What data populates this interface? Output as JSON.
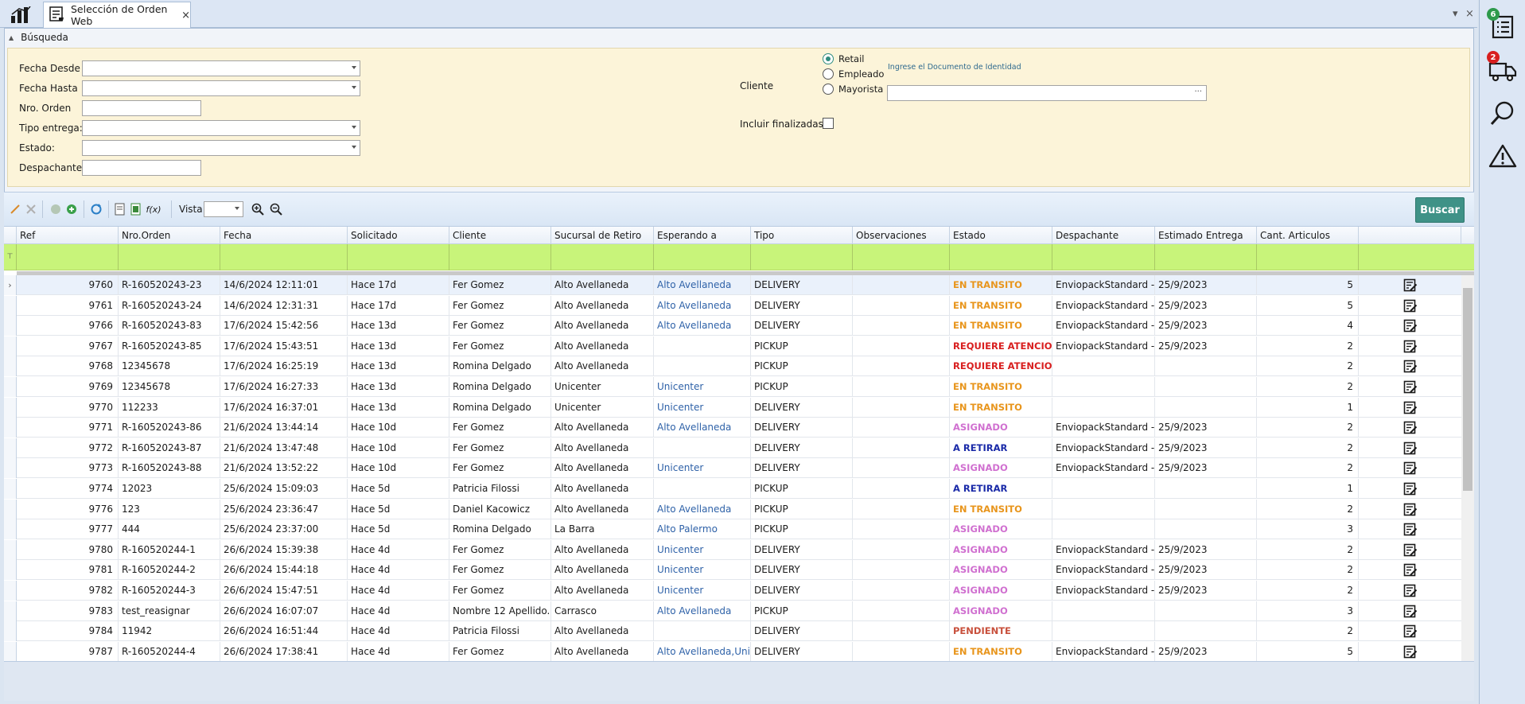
{
  "tab": {
    "title": "Selección de Orden Web",
    "close": "×"
  },
  "window": {
    "menu": "▾",
    "close": "×"
  },
  "search": {
    "section_title": "Búsqueda",
    "fecha_desde_label": "Fecha Desde",
    "fecha_hasta_label": "Fecha Hasta",
    "nro_orden_label": "Nro. Orden",
    "tipo_entrega_label": "Tipo entrega:",
    "estado_label": "Estado:",
    "despachante_label": "Despachante:",
    "cliente_label": "Cliente",
    "cliente_options": [
      "Retail",
      "Empleado",
      "Mayorista"
    ],
    "cliente_selected": "Retail",
    "documento_hint": "Ingrese el Documento de Identidad",
    "documento_dots": "···",
    "incluir_finalizadas_label": "Incluir finalizadas"
  },
  "toolbar": {
    "vista_label": "Vista",
    "search_button": "Buscar"
  },
  "grid": {
    "columns": [
      "Ref",
      "Nro.Orden",
      "Fecha",
      "Solicitado",
      "Cliente",
      "Sucursal de Retiro",
      "Esperando a",
      "Tipo",
      "Observaciones",
      "Estado",
      "Despachante",
      "Estimado Entrega",
      "Cant. Articulos"
    ],
    "rows": [
      {
        "ref": "9760",
        "orden": "R-160520243-23",
        "fecha": "14/6/2024 12:11:01",
        "solicitado": "Hace 17d",
        "cliente": "Fer Gomez",
        "sucursal": "Alto Avellaneda",
        "esperando": "Alto Avellaneda",
        "tipo": "DELIVERY",
        "obs": "",
        "estado": "EN TRANSITO",
        "despachante": "EnviopackStandard -...",
        "estimado": "25/9/2023",
        "cant": "5"
      },
      {
        "ref": "9761",
        "orden": "R-160520243-24",
        "fecha": "14/6/2024 12:31:31",
        "solicitado": "Hace 17d",
        "cliente": "Fer Gomez",
        "sucursal": "Alto Avellaneda",
        "esperando": "Alto Avellaneda",
        "tipo": "DELIVERY",
        "obs": "",
        "estado": "EN TRANSITO",
        "despachante": "EnviopackStandard -...",
        "estimado": "25/9/2023",
        "cant": "5"
      },
      {
        "ref": "9766",
        "orden": "R-160520243-83",
        "fecha": "17/6/2024 15:42:56",
        "solicitado": "Hace 13d",
        "cliente": "Fer Gomez",
        "sucursal": "Alto Avellaneda",
        "esperando": "Alto Avellaneda",
        "tipo": "DELIVERY",
        "obs": "",
        "estado": "EN TRANSITO",
        "despachante": "EnviopackStandard -...",
        "estimado": "25/9/2023",
        "cant": "4"
      },
      {
        "ref": "9767",
        "orden": "R-160520243-85",
        "fecha": "17/6/2024 15:43:51",
        "solicitado": "Hace 13d",
        "cliente": "Fer Gomez",
        "sucursal": "Alto Avellaneda",
        "esperando": "",
        "tipo": "PICKUP",
        "obs": "",
        "estado": "REQUIERE ATENCION",
        "despachante": "EnviopackStandard -...",
        "estimado": "25/9/2023",
        "cant": "2"
      },
      {
        "ref": "9768",
        "orden": "12345678",
        "fecha": "17/6/2024 16:25:19",
        "solicitado": "Hace 13d",
        "cliente": "Romina Delgado",
        "sucursal": "Alto Avellaneda",
        "esperando": "",
        "tipo": "PICKUP",
        "obs": "",
        "estado": "REQUIERE ATENCION",
        "despachante": "",
        "estimado": "",
        "cant": "2"
      },
      {
        "ref": "9769",
        "orden": "12345678",
        "fecha": "17/6/2024 16:27:33",
        "solicitado": "Hace 13d",
        "cliente": "Romina Delgado",
        "sucursal": "Unicenter",
        "esperando": "Unicenter",
        "tipo": "PICKUP",
        "obs": "",
        "estado": "EN TRANSITO",
        "despachante": "",
        "estimado": "",
        "cant": "2"
      },
      {
        "ref": "9770",
        "orden": "112233",
        "fecha": "17/6/2024 16:37:01",
        "solicitado": "Hace 13d",
        "cliente": "Romina Delgado",
        "sucursal": "Unicenter",
        "esperando": "Unicenter",
        "tipo": "DELIVERY",
        "obs": "",
        "estado": "EN TRANSITO",
        "despachante": "",
        "estimado": "",
        "cant": "1"
      },
      {
        "ref": "9771",
        "orden": "R-160520243-86",
        "fecha": "21/6/2024 13:44:14",
        "solicitado": "Hace 10d",
        "cliente": "Fer Gomez",
        "sucursal": "Alto Avellaneda",
        "esperando": "Alto Avellaneda",
        "tipo": "DELIVERY",
        "obs": "",
        "estado": "ASIGNADO",
        "despachante": "EnviopackStandard -...",
        "estimado": "25/9/2023",
        "cant": "2"
      },
      {
        "ref": "9772",
        "orden": "R-160520243-87",
        "fecha": "21/6/2024 13:47:48",
        "solicitado": "Hace 10d",
        "cliente": "Fer Gomez",
        "sucursal": "Alto Avellaneda",
        "esperando": "",
        "tipo": "DELIVERY",
        "obs": "",
        "estado": "A RETIRAR",
        "despachante": "EnviopackStandard -...",
        "estimado": "25/9/2023",
        "cant": "2"
      },
      {
        "ref": "9773",
        "orden": "R-160520243-88",
        "fecha": "21/6/2024 13:52:22",
        "solicitado": "Hace 10d",
        "cliente": "Fer Gomez",
        "sucursal": "Alto Avellaneda",
        "esperando": "Unicenter",
        "tipo": "DELIVERY",
        "obs": "",
        "estado": "ASIGNADO",
        "despachante": "EnviopackStandard -...",
        "estimado": "25/9/2023",
        "cant": "2"
      },
      {
        "ref": "9774",
        "orden": "12023",
        "fecha": "25/6/2024 15:09:03",
        "solicitado": "Hace 5d",
        "cliente": "Patricia Filossi",
        "sucursal": "Alto Avellaneda",
        "esperando": "",
        "tipo": "PICKUP",
        "obs": "",
        "estado": "A RETIRAR",
        "despachante": "",
        "estimado": "",
        "cant": "1"
      },
      {
        "ref": "9776",
        "orden": "123",
        "fecha": "25/6/2024 23:36:47",
        "solicitado": "Hace 5d",
        "cliente": "Daniel Kacowicz",
        "sucursal": "Alto Avellaneda",
        "esperando": "Alto Avellaneda",
        "tipo": "PICKUP",
        "obs": "",
        "estado": "EN TRANSITO",
        "despachante": "",
        "estimado": "",
        "cant": "2"
      },
      {
        "ref": "9777",
        "orden": "444",
        "fecha": "25/6/2024 23:37:00",
        "solicitado": "Hace 5d",
        "cliente": "Romina Delgado",
        "sucursal": "La Barra",
        "esperando": "Alto Palermo",
        "tipo": "PICKUP",
        "obs": "",
        "estado": "ASIGNADO",
        "despachante": "",
        "estimado": "",
        "cant": "3"
      },
      {
        "ref": "9780",
        "orden": "R-160520244-1",
        "fecha": "26/6/2024 15:39:38",
        "solicitado": "Hace 4d",
        "cliente": "Fer Gomez",
        "sucursal": "Alto Avellaneda",
        "esperando": "Unicenter",
        "tipo": "DELIVERY",
        "obs": "",
        "estado": "ASIGNADO",
        "despachante": "EnviopackStandard -...",
        "estimado": "25/9/2023",
        "cant": "2"
      },
      {
        "ref": "9781",
        "orden": "R-160520244-2",
        "fecha": "26/6/2024 15:44:18",
        "solicitado": "Hace 4d",
        "cliente": "Fer Gomez",
        "sucursal": "Alto Avellaneda",
        "esperando": "Unicenter",
        "tipo": "DELIVERY",
        "obs": "",
        "estado": "ASIGNADO",
        "despachante": "EnviopackStandard -...",
        "estimado": "25/9/2023",
        "cant": "2"
      },
      {
        "ref": "9782",
        "orden": "R-160520244-3",
        "fecha": "26/6/2024 15:47:51",
        "solicitado": "Hace 4d",
        "cliente": "Fer Gomez",
        "sucursal": "Alto Avellaneda",
        "esperando": "Unicenter",
        "tipo": "DELIVERY",
        "obs": "",
        "estado": "ASIGNADO",
        "despachante": "EnviopackStandard -...",
        "estimado": "25/9/2023",
        "cant": "2"
      },
      {
        "ref": "9783",
        "orden": "test_reasignar",
        "fecha": "26/6/2024 16:07:07",
        "solicitado": "Hace 4d",
        "cliente": "Nombre 12 Apellido...",
        "sucursal": "Carrasco",
        "esperando": "Alto Avellaneda",
        "tipo": "PICKUP",
        "obs": "",
        "estado": "ASIGNADO",
        "despachante": "",
        "estimado": "",
        "cant": "3"
      },
      {
        "ref": "9784",
        "orden": "11942",
        "fecha": "26/6/2024 16:51:44",
        "solicitado": "Hace 4d",
        "cliente": "Patricia Filossi",
        "sucursal": "Alto Avellaneda",
        "esperando": "",
        "tipo": "DELIVERY",
        "obs": "",
        "estado": "PENDIENTE",
        "despachante": "",
        "estimado": "",
        "cant": "2"
      },
      {
        "ref": "9787",
        "orden": "R-160520244-4",
        "fecha": "26/6/2024 17:38:41",
        "solicitado": "Hace 4d",
        "cliente": "Fer Gomez",
        "sucursal": "Alto Avellaneda",
        "esperando": "Alto Avellaneda,Uni",
        "tipo": "DELIVERY",
        "obs": "",
        "estado": "EN TRANSITO",
        "despachante": "EnviopackStandard -...",
        "estimado": "25/9/2023",
        "cant": "5"
      }
    ]
  },
  "status_colors": {
    "EN TRANSITO": "#e8951c",
    "REQUIERE ATENCION": "#d81e1e",
    "ASIGNADO": "#d070d0",
    "A RETIRAR": "#1a2aa8",
    "PENDIENTE": "#c8503c"
  },
  "sidepanel": {
    "orders_badge": "6",
    "delivery_badge": "2"
  },
  "colors": {
    "accent": "#3f9287",
    "filter_row": "#c8f47a",
    "search_panel": "#fcf4d9"
  }
}
